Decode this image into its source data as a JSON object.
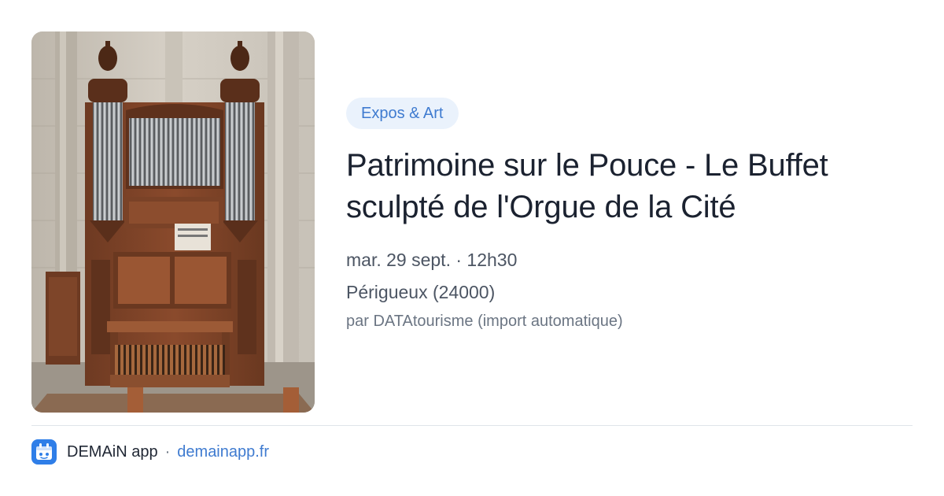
{
  "event": {
    "category_badge": "Expos & Art",
    "title": "Patrimoine sur le Pouce - Le Buffet sculpté de l'Orgue de la Cité",
    "date_time": "mar. 29 sept. · 12h30",
    "location": "Périgueux (24000)",
    "source": "par DATAtourisme (import automatique)",
    "image_subject": "pipe-organ-photo"
  },
  "footer": {
    "app_name": "DEMAiN app",
    "separator": "·",
    "app_url": "demainapp.fr",
    "logo_icon": "demain-app-logo-icon"
  },
  "colors": {
    "badge_bg": "#eaf2fc",
    "accent": "#3f7bd0",
    "logo_bg": "#2f7ee8",
    "title_text": "#1b2230",
    "meta_text": "#4c5563",
    "muted_text": "#6b7583"
  }
}
